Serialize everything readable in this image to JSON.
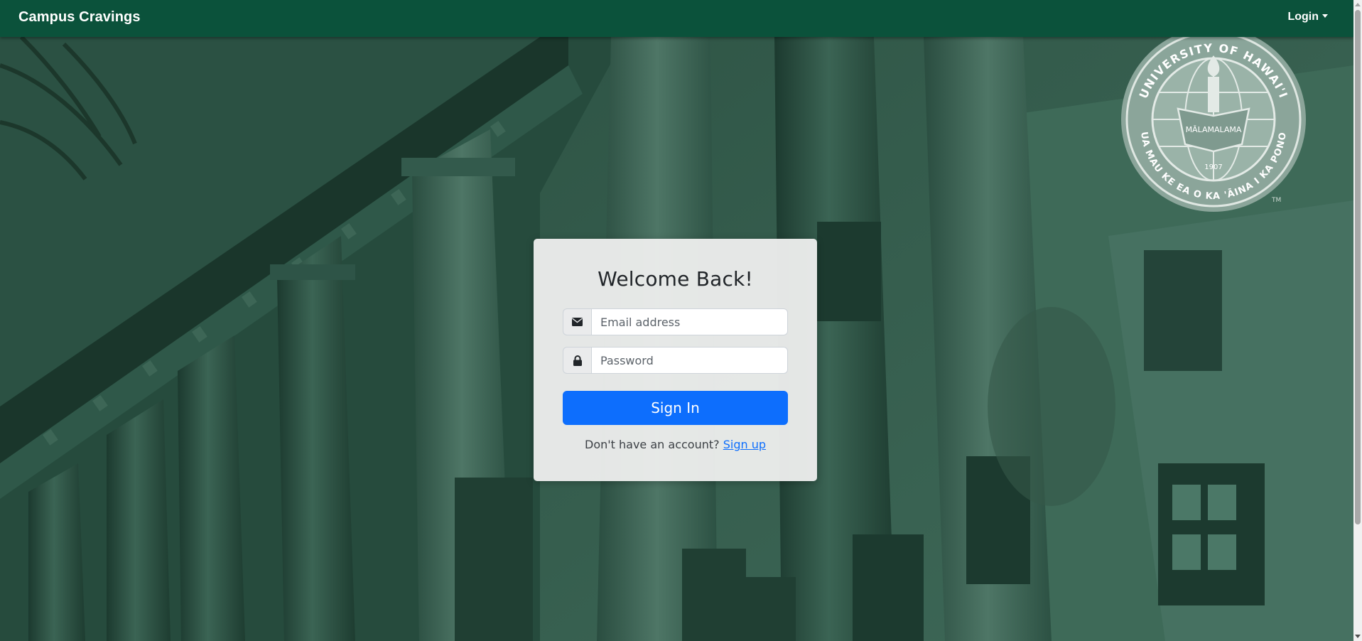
{
  "app": {
    "brand": "Campus Cravings"
  },
  "nav": {
    "login_label": "Login"
  },
  "login_card": {
    "title": "Welcome Back!",
    "email": {
      "value": "",
      "placeholder": "Email address",
      "icon": "envelope-icon"
    },
    "password": {
      "value": "",
      "placeholder": "Password",
      "icon": "lock-icon"
    },
    "submit_label": "Sign In",
    "signup_prompt": "Don't have an account?",
    "signup_link": "Sign up"
  },
  "seal": {
    "top_text": "UNIVERSITY OF HAWAI'I",
    "bottom_text": "UA MAU KE EA O KA 'ĀINA I KA PONO",
    "banner_text": "MĀLAMALAMA",
    "year": "1907",
    "trademark": "TM"
  },
  "theme": {
    "nav_bg": "#0b523b",
    "overlay": "#254a3c",
    "primary": "#0d6efd"
  }
}
